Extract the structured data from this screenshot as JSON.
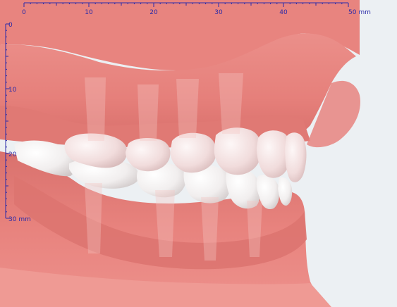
{
  "viewer": {
    "background_color": "#ecf0f3",
    "gingiva_color": "#e8807c",
    "tooth_color": "#f4f2f2",
    "ruler_color": "#2a2aa8"
  },
  "ruler_top": {
    "unit": "mm",
    "labels": [
      "0",
      "10",
      "20",
      "30",
      "40",
      "50 mm"
    ]
  },
  "ruler_left": {
    "unit": "mm",
    "labels": [
      "0",
      "10",
      "20",
      "30 mm"
    ]
  }
}
